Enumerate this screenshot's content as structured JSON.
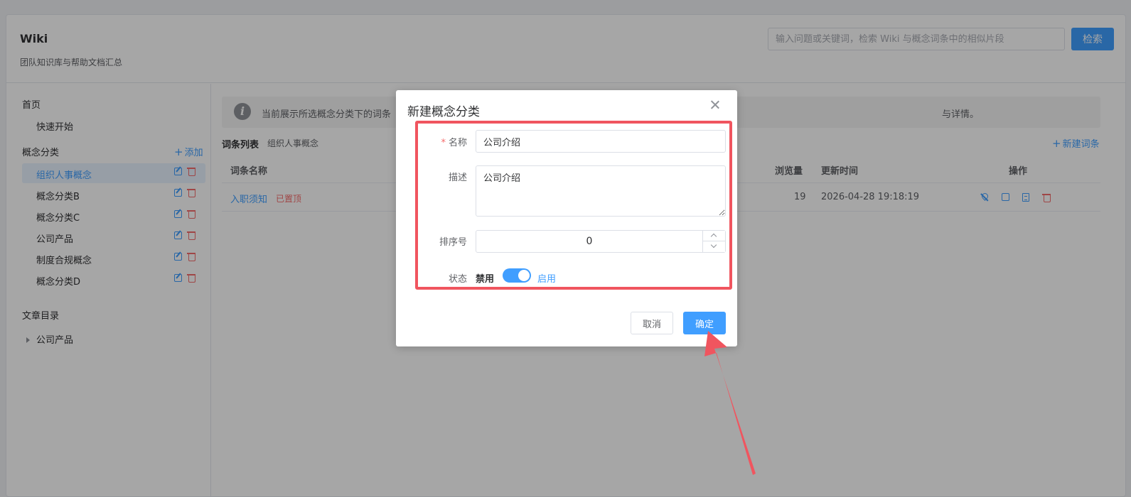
{
  "header": {
    "title": "Wiki",
    "subtitle": "团队知识库与帮助文档汇总",
    "search_placeholder": "输入问题或关键词，检索 Wiki 与概念词条中的相似片段",
    "search_button": "检索"
  },
  "sidebar": {
    "home_heading": "首页",
    "quick_start": "快速开始",
    "category_heading": "概念分类",
    "add_label": "添加",
    "categories": [
      {
        "label": "组织人事概念",
        "active": true
      },
      {
        "label": "概念分类B",
        "active": false
      },
      {
        "label": "概念分类C",
        "active": false
      },
      {
        "label": "公司产品",
        "active": false
      },
      {
        "label": "制度合规概念",
        "active": false
      },
      {
        "label": "概念分类D",
        "active": false
      }
    ],
    "articles_heading": "文章目录",
    "article_tree": [
      {
        "label": "公司产品"
      }
    ]
  },
  "main": {
    "notice_text": "当前展示所选概念分类下的词条",
    "notice_tail": "与详情。",
    "list_title": "词条列表",
    "list_category": "组织人事概念",
    "new_term_label": "新建词条",
    "columns": {
      "name": "词条名称",
      "views": "浏览量",
      "updated": "更新时间",
      "actions": "操作"
    },
    "rows": [
      {
        "name": "入职须知",
        "badge": "已置顶",
        "views": "19",
        "updated": "2026-04-28 19:18:19"
      }
    ]
  },
  "dialog": {
    "title": "新建概念分类",
    "name_label": "名称",
    "name_value": "公司介绍",
    "desc_label": "描述",
    "desc_value": "公司介绍",
    "sort_label": "排序号",
    "sort_value": "0",
    "status_label": "状态",
    "status_off": "禁用",
    "status_on": "启用",
    "status_enabled": true,
    "cancel_button": "取消",
    "ok_button": "确定"
  },
  "colors": {
    "primary": "#409eff",
    "danger": "#f56c6c",
    "annotation": "#f0555f"
  }
}
